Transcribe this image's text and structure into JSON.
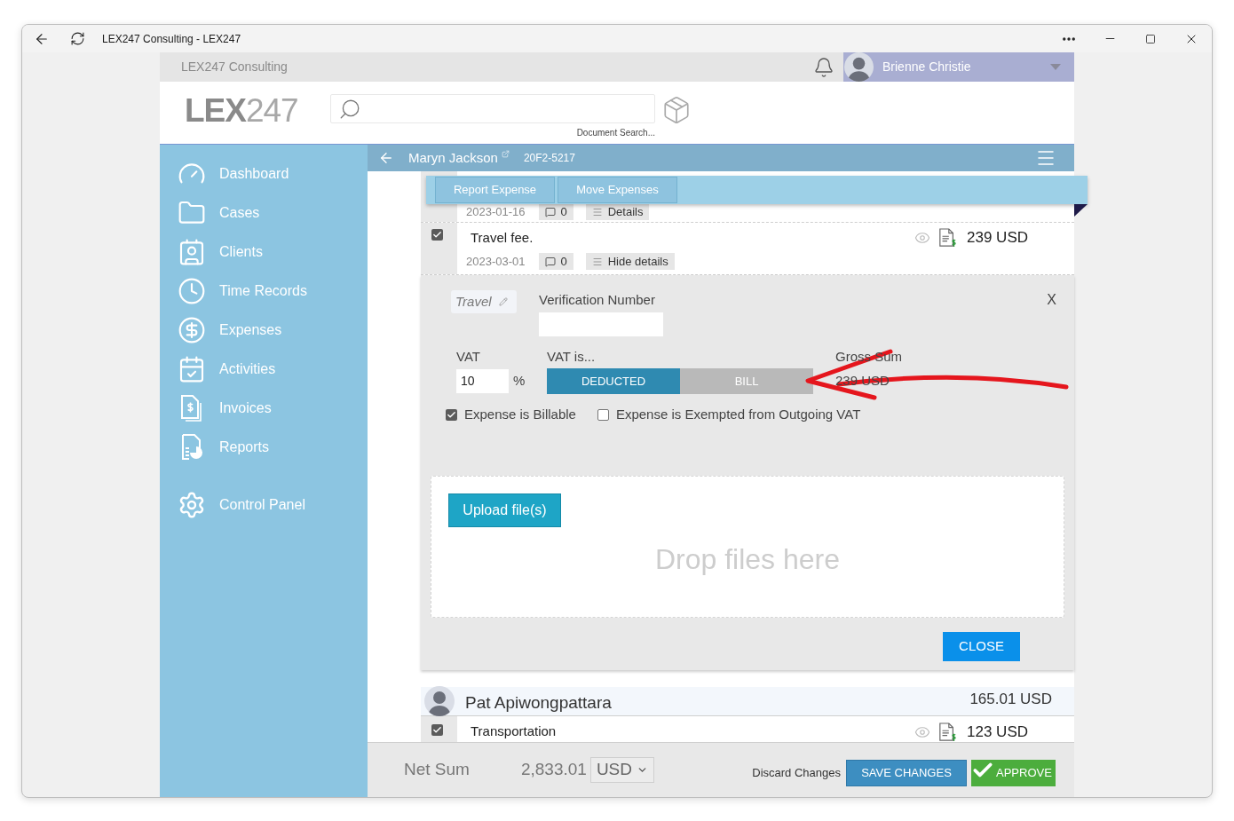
{
  "window": {
    "title": "LEX247 Consulting - LEX247"
  },
  "top_bar": {
    "company": "LEX247 Consulting",
    "user_name": "Brienne Christie"
  },
  "header": {
    "logo": "**LEX**247",
    "search_caption": "Document Search..."
  },
  "sidebar": {
    "items": [
      {
        "label": "Dashboard",
        "kind": "dashboard",
        "selected": false
      },
      {
        "label": "Cases",
        "kind": "cases",
        "selected": false
      },
      {
        "label": "Clients",
        "kind": "clients",
        "selected": false
      },
      {
        "label": "Time Records",
        "kind": "time",
        "selected": false
      },
      {
        "label": "Expenses",
        "kind": "expenses",
        "selected": false
      },
      {
        "label": "Activities",
        "kind": "activities",
        "selected": false
      },
      {
        "label": "Invoices",
        "kind": "invoices",
        "selected": false
      },
      {
        "label": "Reports",
        "kind": "reports",
        "selected": false
      }
    ],
    "bottom_items": [
      {
        "label": "Control Panel",
        "kind": "settings",
        "selected": false
      }
    ]
  },
  "case_bar": {
    "client": "Maryn Jackson",
    "case_number": "20F2-5217"
  },
  "toolbar": {
    "buttons": [
      "Report Expense",
      "Move Expenses"
    ]
  },
  "partial_row": {
    "date": "2023-01-16",
    "comments": "0",
    "details_toggle": "Details"
  },
  "rows": [
    {
      "checked": true,
      "description": "Travel fee.",
      "amount": "239 USD",
      "date": "2023-03-01",
      "comments": "0",
      "details_toggle": "Hide details",
      "expanded": true
    }
  ],
  "details": {
    "category": "Travel",
    "verification_label": "Verification Number",
    "close_x": "X",
    "vat": {
      "label": "VAT",
      "value": "10",
      "unit": "%"
    },
    "vat_mode": {
      "label": "VAT is...",
      "options": [
        {
          "label": "DEDUCTED",
          "selected": true
        },
        {
          "label": "BILL",
          "selected": false
        }
      ]
    },
    "gross_sum": {
      "label": "Gross Sum",
      "value": "239 USD"
    },
    "checkboxes": [
      {
        "label": "Expense is Billable",
        "checked": true
      },
      {
        "label": "Expense is Exempted from Outgoing VAT",
        "checked": false
      }
    ],
    "upload_button": "Upload file(s)",
    "drop_hint": "Drop files here",
    "close_button": "CLOSE"
  },
  "person": {
    "name": "Pat Apiwongpattara",
    "total": "165.01 USD",
    "rows": [
      {
        "checked": true,
        "description": "Transportation",
        "amount": "123 USD"
      }
    ]
  },
  "footer": {
    "net_sum_label": "Net Sum",
    "net_sum": "2,833.01",
    "currency": "USD",
    "discard": "Discard Changes",
    "save": "SAVE CHANGES",
    "approve": "APPROVE"
  }
}
